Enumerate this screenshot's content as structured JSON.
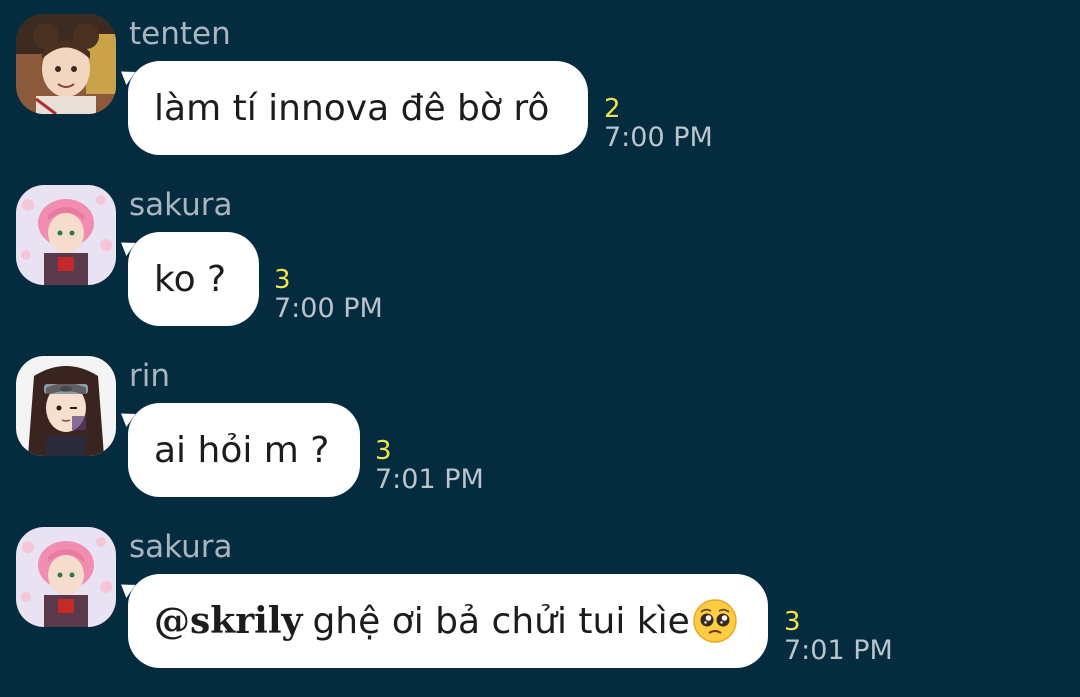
{
  "messages": [
    {
      "sender": "tenten",
      "text": "làm tí innova đê bờ rô",
      "count": "2",
      "time": "7:00 PM",
      "avatar_icon": "tenten-avatar"
    },
    {
      "sender": "sakura",
      "text": "ko ?",
      "count": "3",
      "time": "7:00 PM",
      "avatar_icon": "sakura-avatar"
    },
    {
      "sender": "rin",
      "text": "ai hỏi m ?",
      "count": "3",
      "time": "7:01 PM",
      "avatar_icon": "rin-avatar"
    },
    {
      "sender": "sakura",
      "mention": "@skrily",
      "text": "ghệ ơi bả chửi tui kìe",
      "emoji": "pleading-face-emoji",
      "count": "3",
      "time": "7:01 PM",
      "avatar_icon": "sakura-avatar"
    }
  ],
  "colors": {
    "background": "#052b3f",
    "bubble": "#ffffff",
    "sender": "#a9b5bf",
    "count": "#f2e24d",
    "time": "#b9c4cc"
  }
}
